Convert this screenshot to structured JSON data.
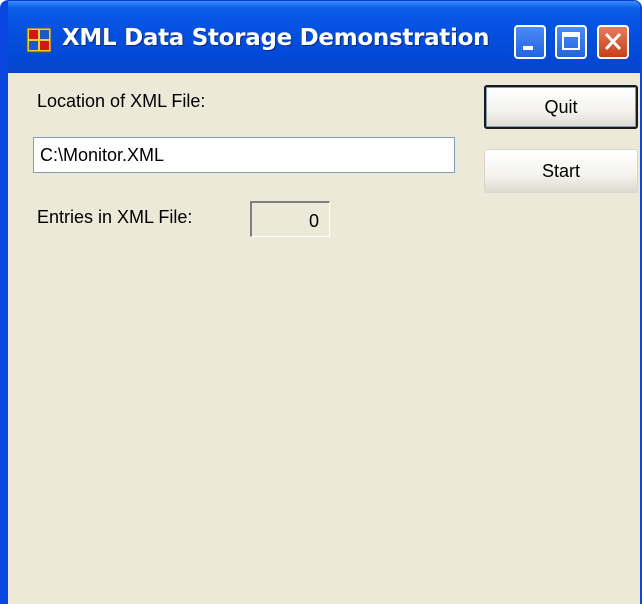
{
  "window": {
    "title": "XML Data Storage Demonstration"
  },
  "form": {
    "location_label": "Location of XML File:",
    "location_value": "C:\\Monitor.XML",
    "entries_label": "Entries in XML File:",
    "entries_value": "0"
  },
  "buttons": {
    "quit_label": "Quit",
    "start_label": "Start"
  },
  "colors": {
    "titlebar": "#0551e0",
    "client_background": "#ece9d8",
    "close_button": "#c8401a"
  }
}
